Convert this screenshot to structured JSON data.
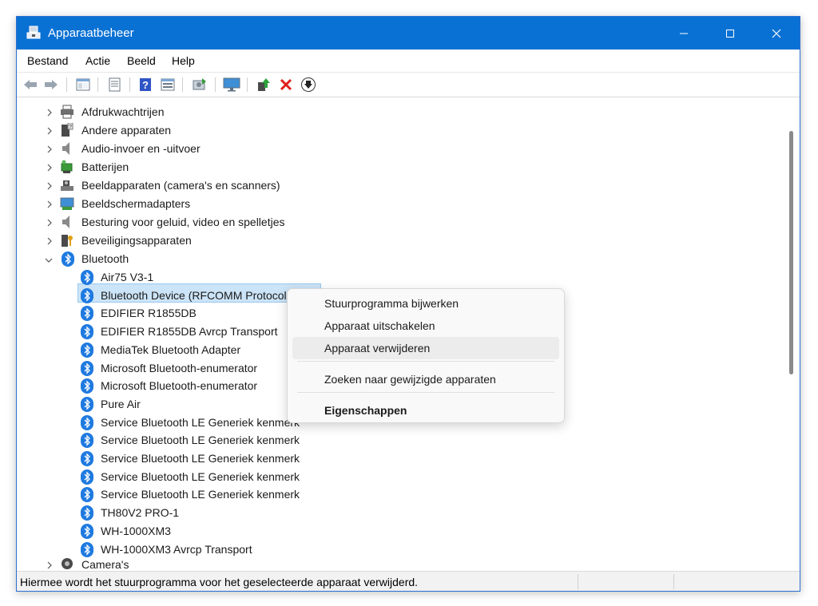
{
  "window": {
    "title": "Apparaatbeheer"
  },
  "menu": [
    "Bestand",
    "Actie",
    "Beeld",
    "Help"
  ],
  "toolbar_icons": [
    "back-arrow-icon",
    "forward-arrow-icon",
    "show-hide-tree-icon",
    "properties-icon",
    "help-icon",
    "view-icon",
    "scan-icon",
    "monitor-icon",
    "update-driver-icon",
    "uninstall-icon",
    "download-icon"
  ],
  "tree": {
    "categories_before": [
      {
        "label": "Afdrukwachtrijen",
        "icon": "printer-icon"
      },
      {
        "label": "Andere apparaten",
        "icon": "other-devices-icon"
      },
      {
        "label": "Audio-invoer en -uitvoer",
        "icon": "speaker-icon"
      },
      {
        "label": "Batterijen",
        "icon": "battery-icon"
      },
      {
        "label": "Beeldapparaten (camera's en scanners)",
        "icon": "camera-scanner-icon"
      },
      {
        "label": "Beeldschermadapters",
        "icon": "display-adapter-icon"
      },
      {
        "label": "Besturing voor geluid, video en spelletjes",
        "icon": "sound-icon"
      },
      {
        "label": "Beveiligingsapparaten",
        "icon": "security-device-icon"
      }
    ],
    "bluetooth": {
      "label": "Bluetooth",
      "children": [
        "Air75 V3-1",
        "Bluetooth Device (RFCOMM Protocol TDI)",
        "EDIFIER R1855DB",
        "EDIFIER R1855DB Avrcp Transport",
        "MediaTek Bluetooth Adapter",
        "Microsoft Bluetooth-enumerator",
        "Microsoft Bluetooth-enumerator",
        "Pure Air",
        "Service Bluetooth LE Generiek kenmerk",
        "Service Bluetooth LE Generiek kenmerk",
        "Service Bluetooth LE Generiek kenmerk",
        "Service Bluetooth LE Generiek kenmerk",
        "Service Bluetooth LE Generiek kenmerk",
        "TH80V2 PRO-1",
        "WH-1000XM3",
        "WH-1000XM3 Avrcp Transport"
      ]
    },
    "categories_after": [
      {
        "label": "Camera's",
        "icon": "camera-icon"
      }
    ]
  },
  "context_menu": {
    "items": [
      "Stuurprogramma bijwerken",
      "Apparaat uitschakelen",
      "Apparaat verwijderen",
      "Zoeken naar gewijzigde apparaten",
      "Eigenschappen"
    ]
  },
  "status": {
    "text": "Hiermee wordt het stuurprogramma voor het geselecteerde apparaat verwijderd."
  }
}
